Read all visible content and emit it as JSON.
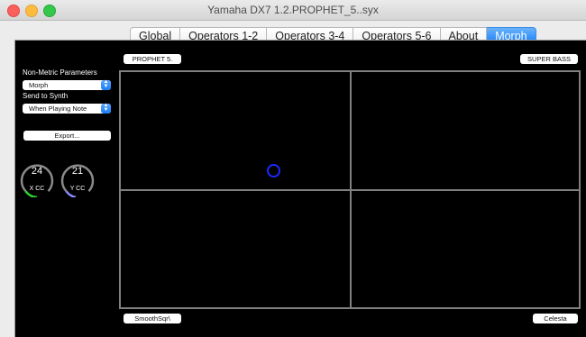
{
  "window": {
    "title": "Yamaha DX7      1.2.PROPHET_5..syx"
  },
  "tabs": [
    "Global",
    "Operators 1-2",
    "Operators 3-4",
    "Operators 5-6",
    "About",
    "Morph"
  ],
  "sidebar": {
    "non_metric_label": "Non-Metric Parameters",
    "non_metric_value": "Morph",
    "send_label": "Send to Synth",
    "send_value": "When Playing Note",
    "export_label": "Export...",
    "x_knob": {
      "value": "24",
      "label": "X CC",
      "color": "#2ed02e"
    },
    "y_knob": {
      "value": "21",
      "label": "Y CC",
      "color": "#8b8bff"
    }
  },
  "corners": {
    "top_left": "PROPHET 5.",
    "top_right": "SUPER BASS",
    "bottom_left": "SmoothSqr\\",
    "bottom_right": "Celesta"
  },
  "colors": {
    "cursor": "#1c28ff",
    "accent": "#1a82fb",
    "grid": "#808080"
  }
}
